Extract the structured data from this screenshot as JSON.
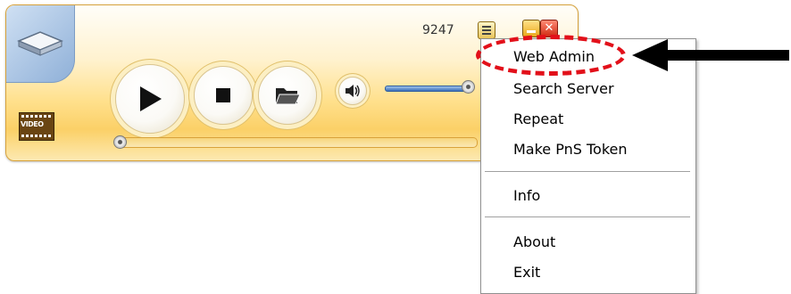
{
  "player": {
    "track_count": "9247",
    "video_badge": "VIDEO",
    "volume_level": 0.92,
    "seek_position": 0.0
  },
  "context_menu": {
    "items": [
      {
        "label": "Web Admin"
      },
      {
        "label": "Search Server"
      },
      {
        "label": "Repeat"
      },
      {
        "label": "Make PnS Token"
      },
      {
        "label": "Info"
      },
      {
        "label": "About"
      },
      {
        "label": "Exit"
      }
    ]
  },
  "colors": {
    "highlight_dashes": "#e2101a",
    "arrow": "#000000",
    "player_accent": "#fbd067",
    "volume_bar": "#3b6fb9"
  },
  "icons": [
    "player-logo-icon",
    "list-icon",
    "minimize-icon",
    "close-icon",
    "play-icon",
    "stop-icon",
    "open-folder-icon",
    "speaker-icon",
    "video-icon"
  ]
}
